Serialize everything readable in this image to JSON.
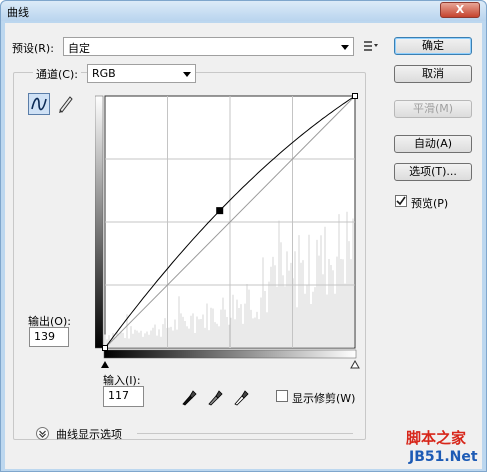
{
  "window": {
    "title": "曲线",
    "close_label": "X"
  },
  "preset": {
    "label": "预设(R):",
    "value": "自定"
  },
  "channel": {
    "label": "通道(C):",
    "value": "RGB"
  },
  "output": {
    "label": "输出(O):",
    "value": "139"
  },
  "input": {
    "label": "输入(I):",
    "value": "117"
  },
  "buttons": {
    "ok": "确定",
    "cancel": "取消",
    "smooth": "平滑(M)",
    "auto": "自动(A)",
    "options": "选项(T)..."
  },
  "preview": {
    "label": "预览(P)",
    "checked": true
  },
  "show_clipping": {
    "label": "显示修剪(W)",
    "checked": false
  },
  "display_options": {
    "label": "曲线显示选项"
  },
  "watermark": {
    "line1": "脚本之家",
    "line2": "JB51.Net"
  },
  "curve": {
    "range": [
      0,
      255
    ],
    "points": [
      [
        0,
        0
      ],
      [
        117,
        139
      ],
      [
        255,
        255
      ]
    ]
  },
  "colors": {
    "curve": "#000000",
    "histogram": "#d6d6d6",
    "watermark_red": "#d7261a",
    "watermark_blue": "#1d5bb5"
  }
}
